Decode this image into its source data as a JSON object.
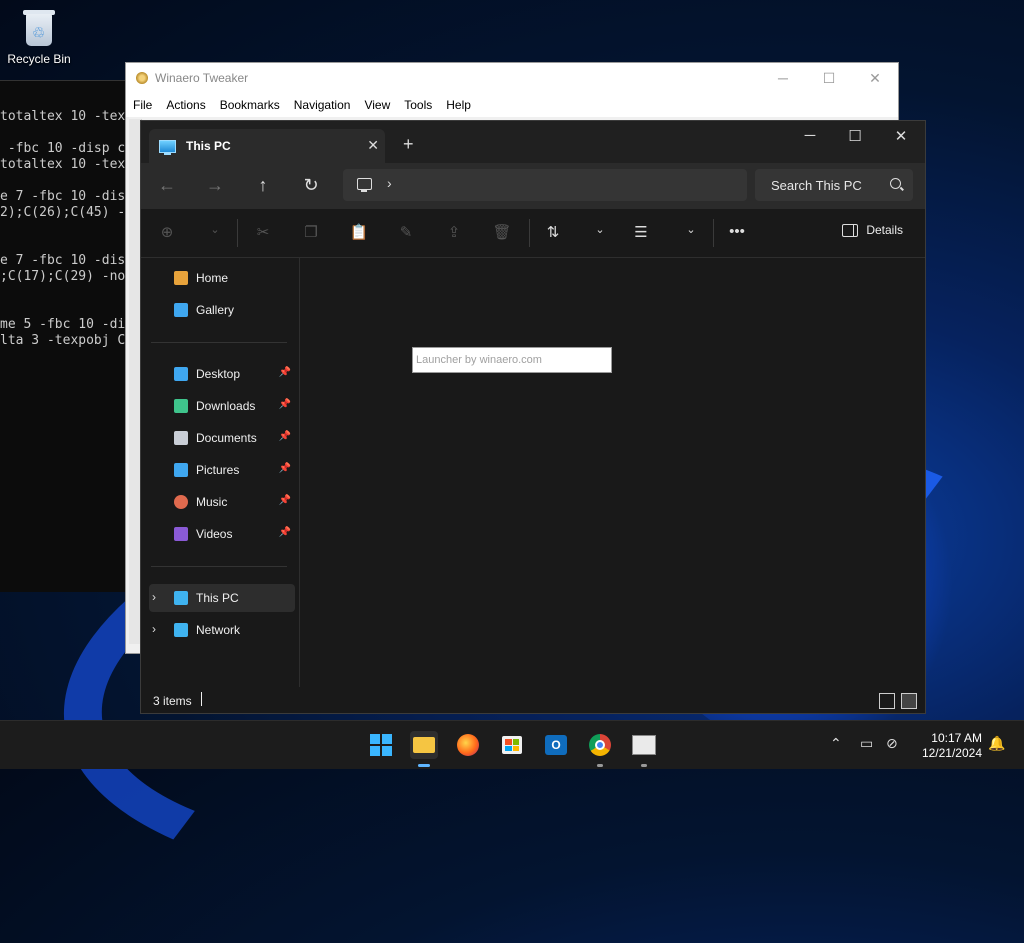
{
  "desktop": {
    "icons": [
      {
        "label": "Recycle Bin"
      }
    ]
  },
  "terminal": {
    "lines": [
      "totaltex 10 -tex",
      "",
      " -fbc 10 -disp c",
      "totaltex 10 -tex",
      "",
      "e 7 -fbc 10 -dis",
      "2);C(26);C(45) -",
      "",
      "",
      "e 7 -fbc 10 -dis",
      ";C(17);C(29) -no",
      "",
      "",
      "me 5 -fbc 10 -di",
      "lta 3 -texpobj C"
    ]
  },
  "tweaker": {
    "title": "Winaero Tweaker",
    "menu": [
      "File",
      "Actions",
      "Bookmarks",
      "Navigation",
      "View",
      "Tools",
      "Help"
    ]
  },
  "explorer": {
    "tab_title": "This PC",
    "search_placeholder": "Search This PC",
    "details_label": "Details",
    "sidebar": {
      "top": [
        {
          "label": "Home",
          "icon": "home-icon",
          "color": "#e8a33b"
        },
        {
          "label": "Gallery",
          "icon": "gallery-icon",
          "color": "#3fa7f0"
        }
      ],
      "pinned": [
        {
          "label": "Desktop",
          "icon": "desktop-folder-icon",
          "color": "#3fa7f0"
        },
        {
          "label": "Downloads",
          "icon": "downloads-icon",
          "color": "#3fc48c"
        },
        {
          "label": "Documents",
          "icon": "documents-icon",
          "color": "#c9ced6"
        },
        {
          "label": "Pictures",
          "icon": "pictures-icon",
          "color": "#3fa7f0"
        },
        {
          "label": "Music",
          "icon": "music-icon",
          "color": "#e06a4e"
        },
        {
          "label": "Videos",
          "icon": "videos-icon",
          "color": "#8a5ad6"
        }
      ],
      "bottom": [
        {
          "label": "This PC",
          "icon": "this-pc-icon",
          "color": "#3fb3f0",
          "selected": true
        },
        {
          "label": "Network",
          "icon": "network-icon",
          "color": "#3fb3f0",
          "selected": false
        }
      ]
    },
    "status_items": "3 items"
  },
  "launcher": {
    "placeholder": "Launcher by winaero.com"
  },
  "taskbar": {
    "apps": [
      "start-icon",
      "file-explorer-icon",
      "firefox-icon",
      "store-icon",
      "outlook-icon",
      "chrome-icon",
      "winaero-icon"
    ],
    "time": "10:17 AM",
    "date": "12/21/2024"
  }
}
